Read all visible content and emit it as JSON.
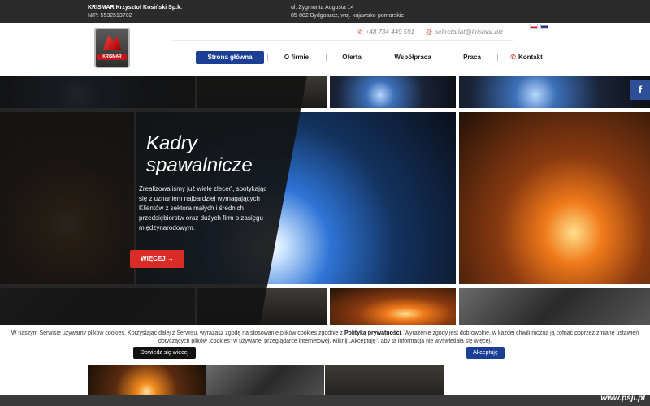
{
  "topbar": {
    "company": "KRISMAR Krzysztof Kosiński Sp.k.",
    "nip": "NIP: 5532513702",
    "street": "ul. Zygmunta Augusta 14",
    "city": "85-082 Bydgoszcz, woj. kujawsko-pomorskie"
  },
  "logo": {
    "text": "KRISMAR"
  },
  "contacts": {
    "phone_icon": "phone-icon",
    "phone": "+48 734 449 591",
    "email_icon": "at-icon",
    "email": "sekretariat@krismar.biz"
  },
  "nav": {
    "items": [
      "Strona główna",
      "O firmie",
      "Oferta",
      "Współpraca",
      "Praca",
      "Kontakt"
    ],
    "active_index": 0
  },
  "hero": {
    "title": "Kadry\nspawalnicze",
    "text": "Zrealizowaliśmy już wiele zleceń, spotykając się z uznaniem najbardziej wymagających Klientów z sektora małych i średnich przedsiębiorstw oraz dużych firm o zasięgu międzynarodowym.",
    "button": "WIĘCEJ",
    "social_icon": "facebook-icon",
    "social_label": "f"
  },
  "cookie": {
    "text_before": "W naszym Serwisie używamy plików cookies. Korzystając dalej z Serwisu, wyrażasz zgodę na stosowanie plików cookies zgodnie z ",
    "policy_link": "Polityką prywatności",
    "text_after": ". Wyrażenie zgody jest dobrowolne, w każdej chwili można ją cofnąć poprzez zmianę ustawień dotyczących plików „cookies” w używanej przeglądarce internetowej. Kliknij „Akceptuję”, aby ta informacja nie wyświetlała się więcej.",
    "settings_button": "Dowiedz się więcej",
    "accept_button": "Akceptuję"
  },
  "watermark": "www.psji.pl",
  "colors": {
    "accent_blue": "#1a3f95",
    "accent_red": "#d92c27",
    "dark": "#2b2b2b"
  }
}
